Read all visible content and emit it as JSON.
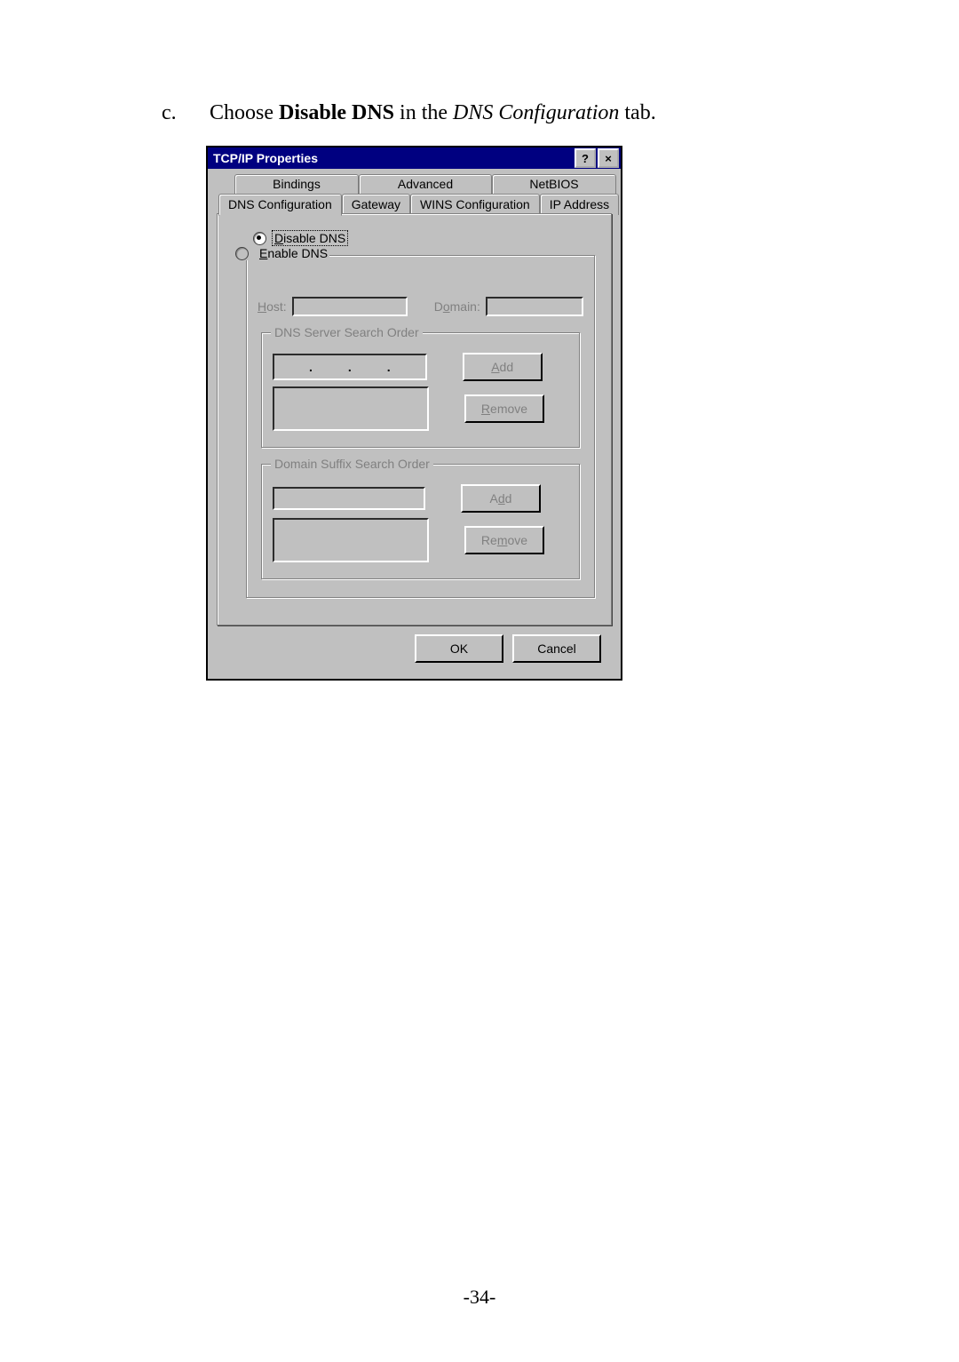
{
  "instruction": {
    "marker": "c.",
    "pre_text": "Choose ",
    "bold": "Disable DNS",
    "mid_text": " in the ",
    "italic": "DNS Configuration",
    "post_text": " tab."
  },
  "dialog": {
    "title": "TCP/IP Properties",
    "help_btn": "?",
    "close_btn": "×",
    "tabs_back": [
      "Bindings",
      "Advanced",
      "NetBIOS"
    ],
    "tabs_front": [
      "DNS Configuration",
      "Gateway",
      "WINS Configuration",
      "IP Address"
    ],
    "active_tab": "DNS Configuration",
    "radio_disable": "Disable DNS",
    "radio_enable": "Enable DNS",
    "host_label": "Host:",
    "domain_label": "Domain:",
    "group1_title": "DNS Server Search Order",
    "group2_title": "Domain Suffix Search Order",
    "add_btn": "Add",
    "remove_btn": "Remove",
    "ok_btn": "OK",
    "cancel_btn": "Cancel"
  },
  "page_number": "-34-"
}
